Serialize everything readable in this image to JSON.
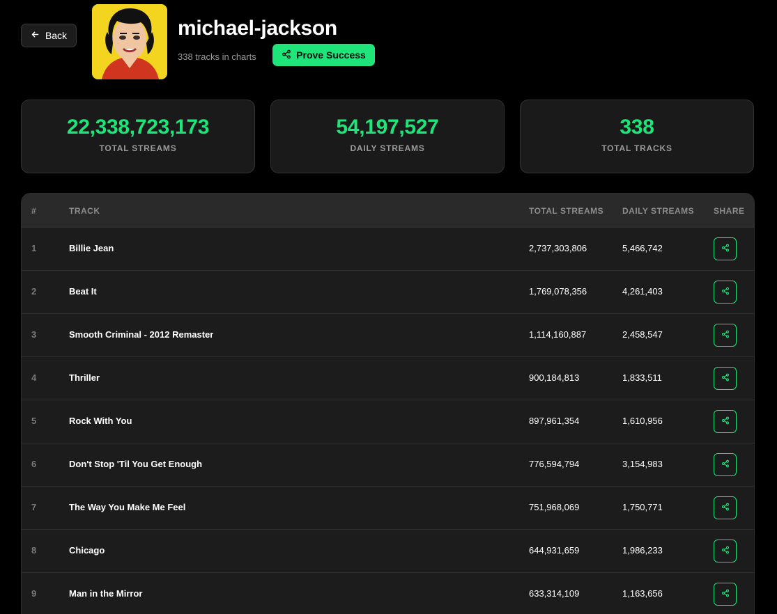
{
  "nav": {
    "back_label": "Back"
  },
  "artist": {
    "name": "michael-jackson",
    "tracks_in_charts": "338 tracks in charts",
    "prove_label": "Prove Success"
  },
  "stats": [
    {
      "value": "22,338,723,173",
      "label": "TOTAL STREAMS"
    },
    {
      "value": "54,197,527",
      "label": "DAILY STREAMS"
    },
    {
      "value": "338",
      "label": "TOTAL TRACKS"
    }
  ],
  "table": {
    "headers": {
      "rank": "#",
      "track": "TRACK",
      "total": "TOTAL STREAMS",
      "daily": "DAILY STREAMS",
      "share": "SHARE"
    },
    "rows": [
      {
        "rank": "1",
        "track": "Billie Jean",
        "total": "2,737,303,806",
        "daily": "5,466,742"
      },
      {
        "rank": "2",
        "track": "Beat It",
        "total": "1,769,078,356",
        "daily": "4,261,403"
      },
      {
        "rank": "3",
        "track": "Smooth Criminal - 2012 Remaster",
        "total": "1,114,160,887",
        "daily": "2,458,547"
      },
      {
        "rank": "4",
        "track": "Thriller",
        "total": "900,184,813",
        "daily": "1,833,511"
      },
      {
        "rank": "5",
        "track": "Rock With You",
        "total": "897,961,354",
        "daily": "1,610,956"
      },
      {
        "rank": "6",
        "track": "Don't Stop 'Til You Get Enough",
        "total": "776,594,794",
        "daily": "3,154,983"
      },
      {
        "rank": "7",
        "track": "The Way You Make Me Feel",
        "total": "751,968,069",
        "daily": "1,750,771"
      },
      {
        "rank": "8",
        "track": "Chicago",
        "total": "644,931,659",
        "daily": "1,986,233"
      },
      {
        "rank": "9",
        "track": "Man in the Mirror",
        "total": "633,314,109",
        "daily": "1,163,656"
      }
    ]
  },
  "colors": {
    "accent": "#1ee47a",
    "background": "#000000",
    "card": "#1a1a1a"
  }
}
